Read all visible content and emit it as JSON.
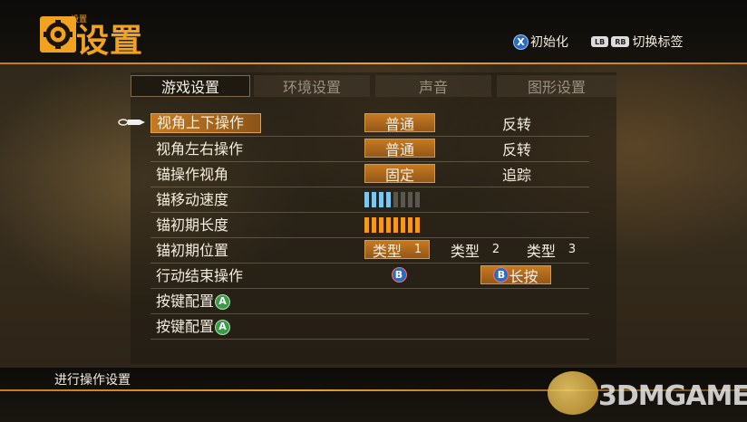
{
  "header": {
    "small_title": "设置",
    "title": "设置",
    "hint_reset": {
      "button": "X",
      "label": "初始化"
    },
    "hint_tabs": {
      "lb": "LB",
      "rb": "RB",
      "label": "切换标签"
    }
  },
  "tabs": [
    {
      "label": "游戏设置",
      "active": true
    },
    {
      "label": "环境设置",
      "active": false
    },
    {
      "label": "声音",
      "active": false
    },
    {
      "label": "图形设置",
      "active": false
    }
  ],
  "rows": {
    "camera_vertical": {
      "label": "视角上下操作",
      "options": [
        "普通",
        "反转"
      ],
      "selected": "普通"
    },
    "camera_horizontal": {
      "label": "视角左右操作",
      "options": [
        "普通",
        "反转"
      ],
      "selected": "普通"
    },
    "anchor_camera": {
      "label": "锚操作视角",
      "options": [
        "固定",
        "追踪"
      ],
      "selected": "固定"
    },
    "anchor_speed": {
      "label": "锚移动速度",
      "level": 4,
      "max": 8
    },
    "anchor_length": {
      "label": "锚初期长度",
      "level": 8,
      "max": 8
    },
    "anchor_position": {
      "label": "锚初期位置",
      "options": [
        {
          "text": "类型",
          "num": "1"
        },
        {
          "text": "类型",
          "num": "2"
        },
        {
          "text": "类型",
          "num": "3"
        }
      ],
      "selected_index": 0
    },
    "end_action": {
      "label": "行动结束操作",
      "option1_button": "B",
      "option2_button": "B",
      "option2_text": "长按",
      "selected_index": 1
    },
    "keyconfig1": {
      "label": "按键配置",
      "button": "A"
    },
    "keyconfig2": {
      "label": "按键配置",
      "button": "A"
    }
  },
  "status_text": "进行操作设置",
  "watermark": "3DMGAME",
  "colors": {
    "accent": "#f1a21e",
    "selected_bg": "#c57a1f",
    "gauge_speed": "#7ec6f0",
    "gauge_length": "#f39a1e"
  }
}
